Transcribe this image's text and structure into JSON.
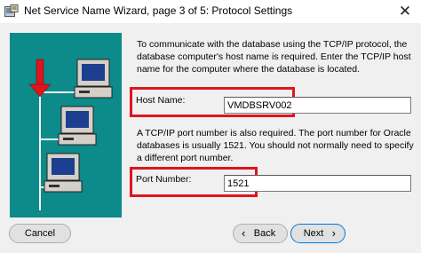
{
  "window": {
    "title": "Net Service Name Wizard, page 3 of 5: Protocol Settings",
    "close_glyph": "✕",
    "icon": "wizard-app-icon"
  },
  "illustration": {
    "background_color": "#0d8a8a",
    "arrow_color": "#e0141e",
    "icons": [
      "computer-icon",
      "computer-icon",
      "computer-icon",
      "red-arrow-icon"
    ]
  },
  "content": {
    "paragraph1": "To communicate with the database using the TCP/IP protocol, the database computer's host name is required.  Enter the TCP/IP host name for the computer where the database is located.",
    "host_name_label": "Host Name:",
    "host_name_value": "VMDBSRV002",
    "paragraph2": "A TCP/IP port number is also required.  The port number for Oracle databases is usually 1521.  You should not normally need to specify a different port number.",
    "port_number_label": "Port Number:",
    "port_number_value": "1521",
    "highlight_color": "#e0141e"
  },
  "buttons": {
    "cancel": "Cancel",
    "back": "Back",
    "back_chevron": "‹",
    "next": "Next",
    "next_chevron": "›"
  }
}
